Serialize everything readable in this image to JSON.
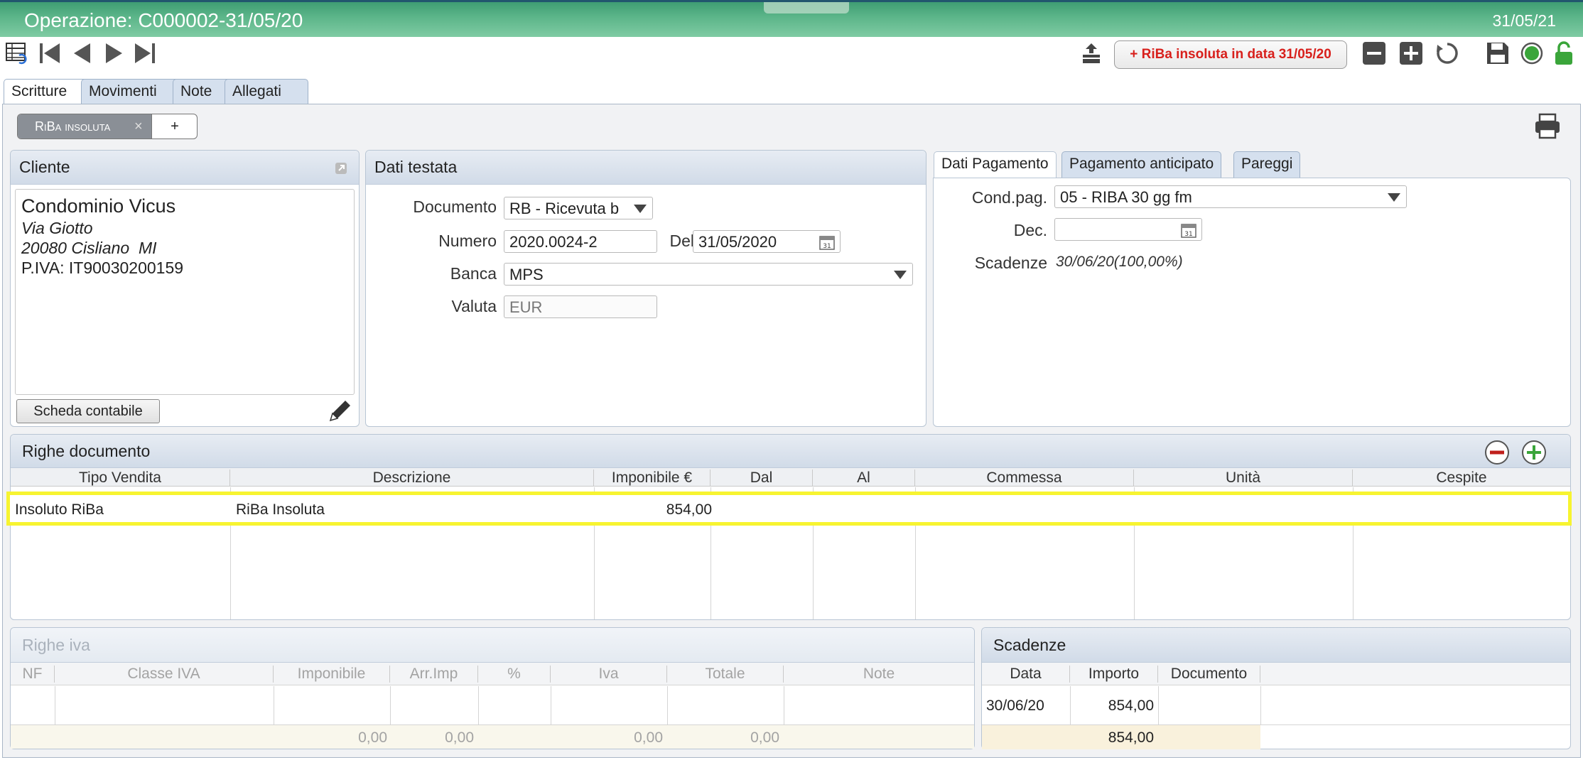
{
  "window": {
    "title": "Operazione: C000002-31/05/20",
    "date": "31/05/21"
  },
  "toolbar": {
    "riba_button": "+ RiBa insoluta in data 31/05/20"
  },
  "tabs": [
    "Scritture",
    "Movimenti",
    "Note",
    "Allegati"
  ],
  "subtab": {
    "label": "RiBa insoluta",
    "close": "×",
    "add": "+"
  },
  "cliente": {
    "title": "Cliente",
    "name": "Condominio Vicus",
    "street": "Via Giotto",
    "city": "20080 Cisliano  MI",
    "piva": "P.IVA: IT90030200159",
    "scheda_button": "Scheda contabile"
  },
  "testata": {
    "title": "Dati testata",
    "documento_label": "Documento",
    "documento_value": "RB - Ricevuta b",
    "numero_label": "Numero",
    "numero_value": "2020.0024-2",
    "del_label": "Del",
    "del_value": "31/05/2020",
    "banca_label": "Banca",
    "banca_value": "MPS",
    "valuta_label": "Valuta",
    "valuta_value": "EUR"
  },
  "pagamento": {
    "tabs": [
      "Dati Pagamento",
      "Pagamento anticipato",
      "Pareggi"
    ],
    "cond_label": "Cond.pag.",
    "cond_value": "05 - RIBA 30 gg fm",
    "dec_label": "Dec.",
    "dec_value": "",
    "scadenze_label": "Scadenze",
    "scadenze_value": "30/06/20(100,00%)"
  },
  "righe_doc": {
    "title": "Righe documento",
    "columns": [
      "Tipo Vendita",
      "Descrizione",
      "Imponibile €",
      "Dal",
      "Al",
      "Commessa",
      "Unità",
      "Cespite"
    ],
    "rows": [
      {
        "tipo": "Insoluto RiBa",
        "descrizione": "RiBa Insoluta",
        "imponibile": "854,00"
      }
    ]
  },
  "righe_iva": {
    "title": "Righe iva",
    "columns": [
      "NF",
      "Classe IVA",
      "Imponibile",
      "Arr.Imp",
      "%",
      "Iva",
      "Totale",
      "Note"
    ],
    "totals": [
      "0,00",
      "0,00",
      "0,00",
      "0,00"
    ]
  },
  "scadenze": {
    "title": "Scadenze",
    "columns": [
      "Data",
      "Importo",
      "Documento"
    ],
    "rows": [
      {
        "data": "30/06/20",
        "importo": "854,00"
      }
    ],
    "total": "854,00"
  },
  "colors": {
    "title_bar": "#5ab488",
    "riba_text": "#d8201c",
    "highlight": "#f7f430"
  }
}
